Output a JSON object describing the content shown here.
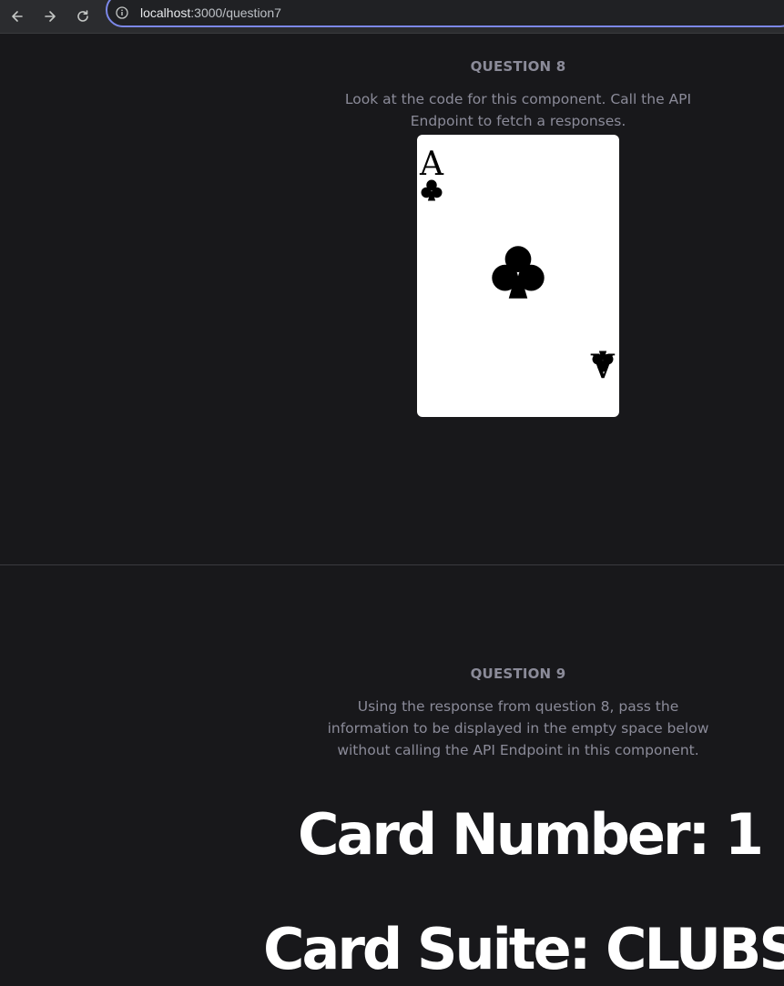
{
  "browser": {
    "url_host": "localhost",
    "url_path": ":3000/question7",
    "accent": "#7c88e8"
  },
  "question8": {
    "label": "QUESTION 8",
    "description_line1": "Look at the code for this component. Call the API",
    "description_line2": "Endpoint to fetch a responses.",
    "card": {
      "rank": "A",
      "suit": "clubs",
      "suit_icon": "club-icon"
    }
  },
  "question9": {
    "label": "QUESTION 9",
    "description_line1": "Using the response from question 8, pass the",
    "description_line2": "information to be displayed in the empty space below",
    "description_line3": "without calling the API Endpoint in this component.",
    "card_number": "Card Number: 1",
    "card_suite": "Card Suite: CLUBS"
  },
  "colors": {
    "background": "#18181b",
    "muted_text": "#8b8b99",
    "heading_text": "#ffffff"
  }
}
